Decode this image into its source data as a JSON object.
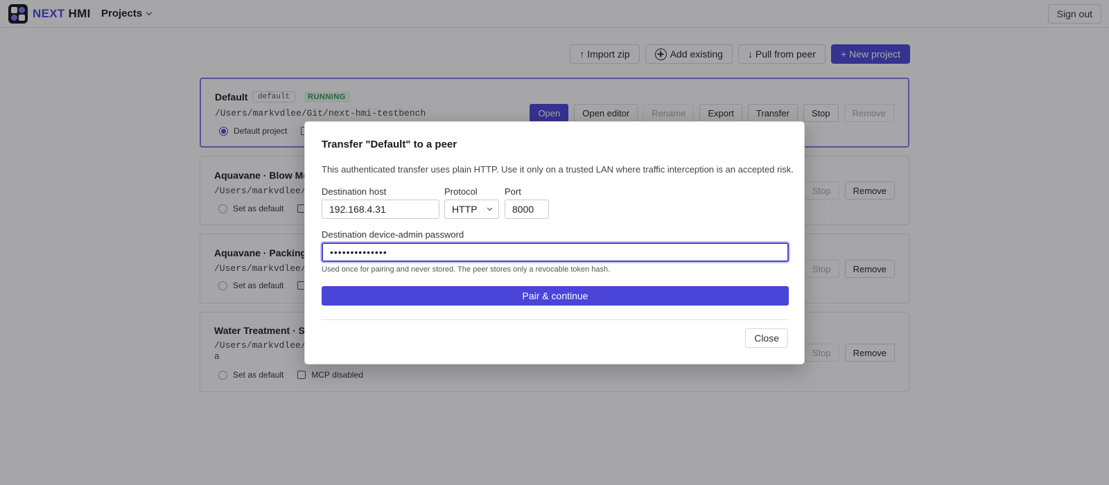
{
  "header": {
    "brand_next": "NEXT",
    "brand_hmi": "HMI",
    "projects_menu": "Projects",
    "sign_out": "Sign out"
  },
  "toolbar": {
    "import_zip": "↑ Import zip",
    "add_existing": "Add existing",
    "pull_from_peer": "↓ Pull from peer",
    "new_project": "+ New project"
  },
  "projects": [
    {
      "name": "Default",
      "tag": "default",
      "status": "RUNNING",
      "path": "/Users/markvdlee/Git/next-hmi-testbench",
      "default_label": "Default project",
      "actions": [
        "Open",
        "Open editor",
        "Rename",
        "Export",
        "Transfer",
        "Stop",
        "Remove"
      ]
    },
    {
      "name": "Aquavane · Blow Mo",
      "path": "/Users/markvdlee/D",
      "default_label": "Set as default",
      "actions": [
        "Stop",
        "Remove"
      ]
    },
    {
      "name": "Aquavane · Packing l",
      "path": "/Users/markvdlee/D",
      "default_label": "Set as default",
      "actions": [
        "Stop",
        "Remove"
      ]
    },
    {
      "name": "Water Treatment · Sk",
      "path": "/Users/markvdlee/D",
      "path_line2": "a",
      "default_label": "Set as default",
      "mcp_label": "MCP disabled",
      "actions": [
        "Stop",
        "Remove"
      ]
    }
  ],
  "modal": {
    "title": "Transfer \"Default\" to a peer",
    "warning": "This authenticated transfer uses plain HTTP. Use it only on a trusted LAN where traffic interception is an accepted risk.",
    "host_label": "Destination host",
    "host_value": "192.168.4.31",
    "protocol_label": "Protocol",
    "protocol_value": "HTTP",
    "port_label": "Port",
    "port_value": "8000",
    "password_label": "Destination device-admin password",
    "password_value": "••••••••••••••",
    "hint": "Used once for pairing and never stored. The peer stores only a revocable token hash.",
    "pair_button": "Pair & continue",
    "close_button": "Close"
  },
  "colors": {
    "accent": "#4a44d8",
    "running": "#2a9a4a"
  }
}
